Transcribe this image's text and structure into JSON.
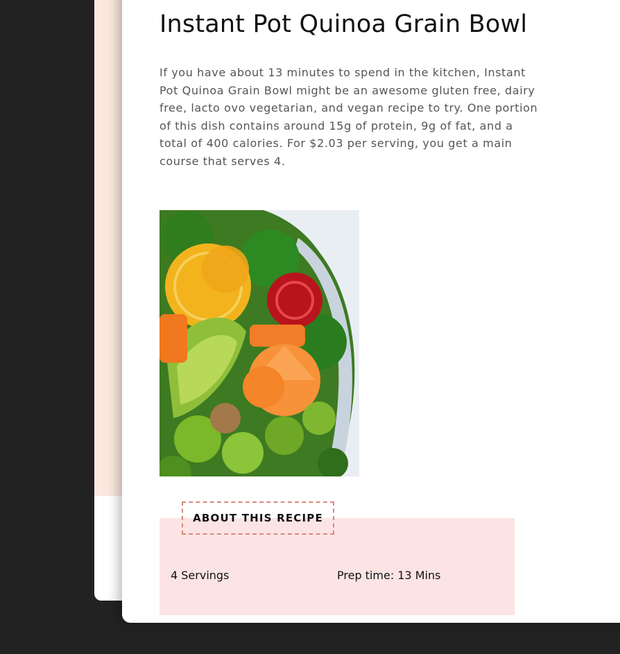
{
  "recipe": {
    "title": "Instant Pot Quinoa Grain Bowl",
    "summary": "If you have about 13 minutes to spend in the kitchen, Instant Pot Quinoa Grain Bowl might be an awesome gluten free, dairy free, lacto ovo vegetarian, and vegan recipe to try. One portion of this dish contains around 15g of protein, 9g of fat, and a total of 400 calories. For $2.03 per serving, you get a main course that serves 4.",
    "image_alt": "Instant Pot Quinoa Grain Bowl",
    "about": {
      "heading": "ABOUT THIS RECIPE",
      "servings": "4 Servings",
      "prep_time": "Prep time: 13 Mins"
    }
  },
  "colors": {
    "backdrop": "#222222",
    "back_card_tint": "#fbe8df",
    "about_background": "#fde4e4",
    "about_tag_border": "#d98a78"
  }
}
